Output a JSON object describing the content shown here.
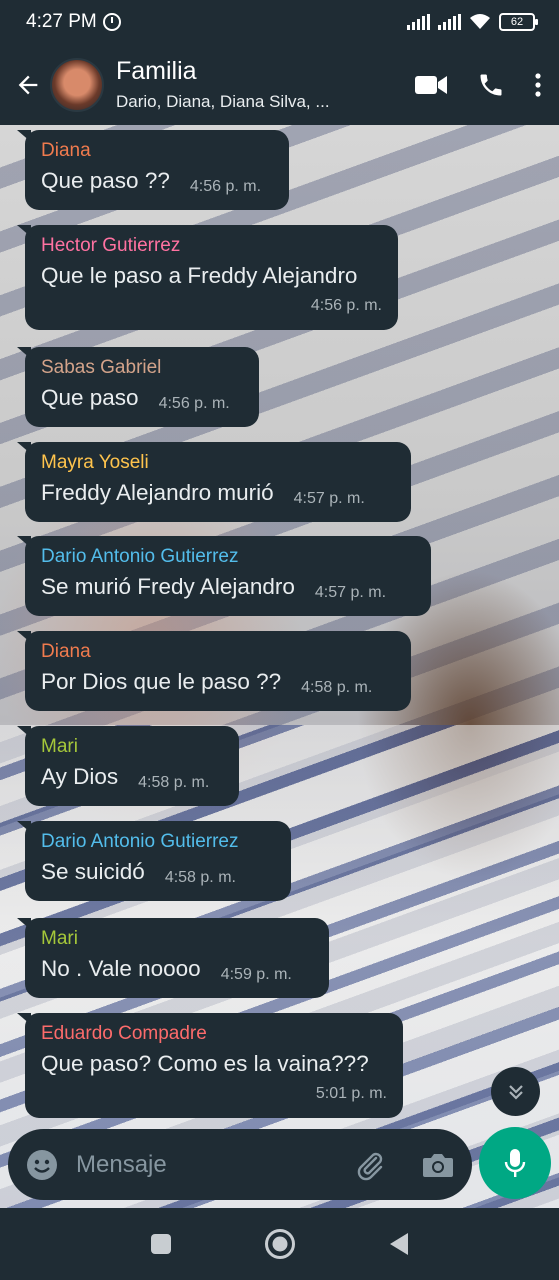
{
  "status_bar": {
    "time": "4:27 PM",
    "battery": "62"
  },
  "header": {
    "title": "Familia",
    "members": "Dario, Diana, Diana Silva, ..."
  },
  "messages": [
    {
      "sender": "Diana",
      "sender_color": "#f07b4e",
      "text": "Que paso ??",
      "time": "4:56 p. m."
    },
    {
      "sender": "Hector Gutierrez",
      "sender_color": "#ff72a1",
      "text": "Que le paso a Freddy Alejandro",
      "time": "4:56 p. m."
    },
    {
      "sender": "Sabas Gabriel",
      "sender_color": "#d3a38a",
      "text": "Que paso",
      "time": "4:56 p. m."
    },
    {
      "sender": "Mayra Yoseli",
      "sender_color": "#ffc44d",
      "text": "Freddy Alejandro murió",
      "time": "4:57 p. m."
    },
    {
      "sender": "Dario Antonio Gutierrez",
      "sender_color": "#53bdeb",
      "text": "Se murió Fredy Alejandro",
      "time": "4:57 p. m."
    },
    {
      "sender": "Diana",
      "sender_color": "#f07b4e",
      "text": "Por Dios que le paso ??",
      "time": "4:58 p. m."
    },
    {
      "sender": "Mari",
      "sender_color": "#a5c73a",
      "text": "Ay Dios",
      "time": "4:58 p. m."
    },
    {
      "sender": "Dario Antonio Gutierrez",
      "sender_color": "#53bdeb",
      "text": "Se suicidó",
      "time": "4:58 p. m."
    },
    {
      "sender": "Mari",
      "sender_color": "#a5c73a",
      "text": "No . Vale noooo",
      "time": "4:59 p. m."
    },
    {
      "sender": "Eduardo Compadre",
      "sender_color": "#fc6b6b",
      "text": "Que paso? Como es la vaina???",
      "time": "5:01 p. m."
    }
  ],
  "input": {
    "placeholder": "Mensaje"
  },
  "icons": {
    "back": "arrow-left",
    "video": "video-camera",
    "call": "phone",
    "menu": "more-vertical",
    "emoji": "smiley",
    "attach": "paperclip",
    "camera": "camera",
    "mic": "microphone",
    "scroll": "double-chevron-down"
  },
  "colors": {
    "bar": "#1f2c34",
    "accent": "#00a884"
  }
}
